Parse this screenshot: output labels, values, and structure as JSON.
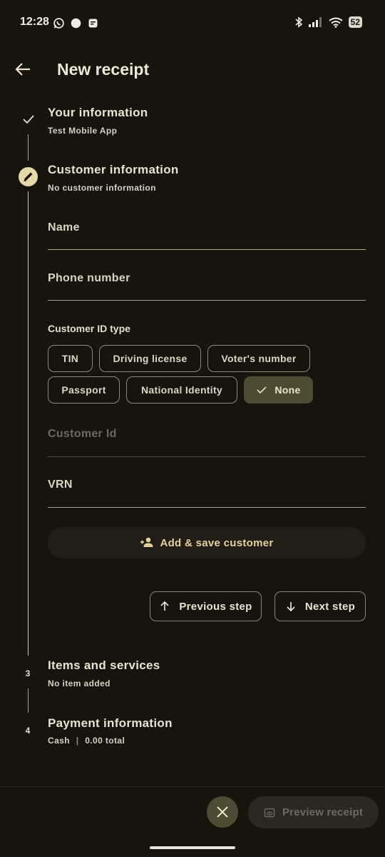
{
  "status_bar": {
    "time": "12:28",
    "battery": "52"
  },
  "app_bar": {
    "title": "New receipt"
  },
  "steps": [
    {
      "title": "Your information",
      "subtitle": "Test Mobile App"
    },
    {
      "title": "Customer information",
      "subtitle": "No customer information"
    },
    {
      "number": "3",
      "title": "Items and services",
      "subtitle": "No item added"
    },
    {
      "number": "4",
      "title": "Payment information",
      "subtitle_method": "Cash",
      "subtitle_sep": "|",
      "subtitle_total": "0.00 total"
    }
  ],
  "form": {
    "name_label": "Name",
    "phone_label": "Phone number",
    "id_type_label": "Customer ID type",
    "id_types": [
      "TIN",
      "Driving license",
      "Voter's number",
      "Passport",
      "National Identity",
      "None"
    ],
    "selected_id_type": "None",
    "customer_id_label": "Customer Id",
    "vrn_label": "VRN",
    "add_customer_label": "Add & save customer"
  },
  "navigation": {
    "previous_label": "Previous step",
    "next_label": "Next step"
  },
  "bottom_bar": {
    "preview_label": "Preview receipt"
  },
  "colors": {
    "accent": "#e3d29c",
    "background": "#17130d",
    "chip_selected": "#4f4a34"
  }
}
